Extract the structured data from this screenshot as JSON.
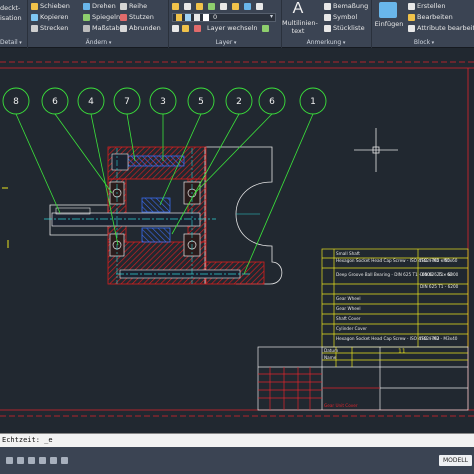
{
  "ribbon": {
    "left_labels": [
      "deckt-",
      "isation",
      "Detail"
    ],
    "modify": {
      "items": [
        {
          "label": "Schieben",
          "icon": "move-icon"
        },
        {
          "label": "Drehen",
          "icon": "rotate-icon"
        },
        {
          "label": "Reihe",
          "icon": "array-icon"
        },
        {
          "label": "Kopieren",
          "icon": "copy-icon"
        },
        {
          "label": "Spiegeln",
          "icon": "mirror-icon"
        },
        {
          "label": "Stutzen",
          "icon": "trim-icon"
        },
        {
          "label": "Strecken",
          "icon": "stretch-icon"
        },
        {
          "label": "Maßstab",
          "icon": "scale-icon"
        },
        {
          "label": "Abrunden",
          "icon": "fillet-icon"
        }
      ],
      "panel_title": "Ändern"
    },
    "layer": {
      "current_layer": "0",
      "items": [
        {
          "label": "Layer wechseln",
          "icon": "layer-match-icon"
        }
      ],
      "panel_title": "Layer"
    },
    "annotation": {
      "big_label_1": "Multilinien-",
      "big_label_2": "text",
      "items": [
        {
          "label": "Bemaßung",
          "icon": "dimension-icon"
        },
        {
          "label": "Symbol",
          "icon": "symbol-icon"
        },
        {
          "label": "Stückliste",
          "icon": "partslist-icon"
        }
      ],
      "panel_title": "Anmerkung"
    },
    "block": {
      "insert_label": "Einfügen",
      "items": [
        {
          "label": "Erstellen",
          "icon": "block-create-icon"
        },
        {
          "label": "Bearbeiten",
          "icon": "block-edit-icon"
        },
        {
          "label": "Attribute bearbeiten",
          "icon": "attribute-edit-icon"
        }
      ],
      "panel_title": "Block"
    }
  },
  "callouts": [
    "8",
    "6",
    "4",
    "7",
    "3",
    "5",
    "2",
    "6",
    "1"
  ],
  "parts_list": {
    "rows": [
      {
        "desc": "Small Shaft",
        "code": ""
      },
      {
        "desc": "Hexagon Socket Head Cap Screw - ISO 4762 - M5 x 50",
        "code": "ISO 4762 - M5x60"
      },
      {
        "desc": "Deep Groove Ball Bearing - DIN 625 T1 - 6000 - 25 x 62",
        "code": "DIN 625 T1 - 6000"
      },
      {
        "desc": "",
        "code": "DIN 625 T1 - 6200"
      },
      {
        "desc": "Gear Wheel",
        "code": ""
      },
      {
        "desc": "Gear Wheel",
        "code": ""
      },
      {
        "desc": "Shaft Cover",
        "code": ""
      },
      {
        "desc": "Cylinder Cover",
        "code": ""
      },
      {
        "desc": "Hexagon Socket Head Cap Screw - ISO 4762 - M3",
        "code": "ISO 4762 - M3x40"
      }
    ]
  },
  "title_block": {
    "field_value": "11",
    "footer_label": "Gear Unit Cover",
    "fields": [
      "Datum",
      "Name"
    ]
  },
  "command_line": {
    "text": "Echtzeit: _e"
  },
  "status_bar": {
    "model_tab": "MODELL"
  },
  "colors": {
    "drawing_bg": "#212830",
    "frame_red": "#e0242c",
    "callout_green": "#3be33b",
    "outline_white": "#e6e6e6",
    "hatch_red": "#d91e1e",
    "parts_yellow": "#e8e21e",
    "blue_fill": "#1f46c8"
  }
}
